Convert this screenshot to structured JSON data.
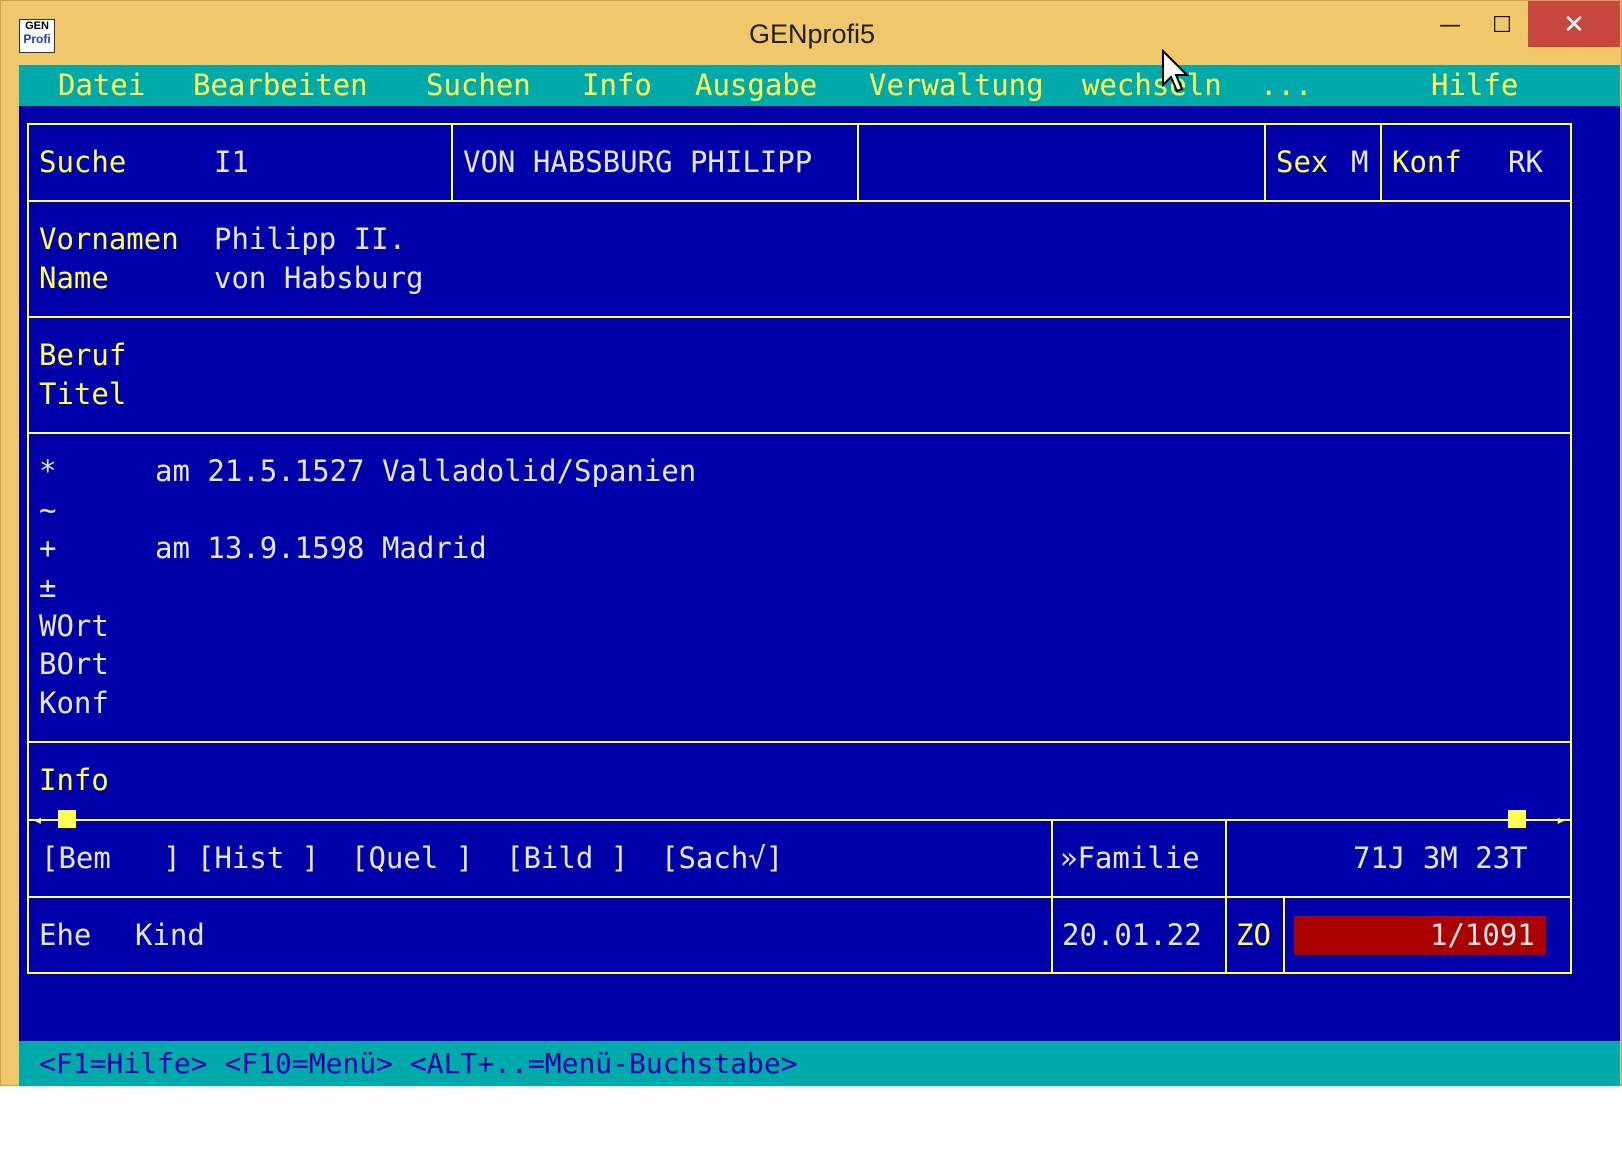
{
  "window": {
    "title": "GENprofi5",
    "icon_top": "GEN",
    "icon_bottom": "Profi",
    "minimize_glyph": "—",
    "maximize_glyph": "☐",
    "close_glyph": "✕"
  },
  "menu": {
    "datei": "Datei",
    "bearbeiten": "Bearbeiten",
    "suchen": "Suchen",
    "info": "Info",
    "ausgabe": "Ausgabe",
    "verwaltung": "Verwaltung",
    "wechseln": "wechseln",
    "more": "...",
    "hilfe": "Hilfe"
  },
  "header": {
    "suche_label": "Suche",
    "suche_value": "I1",
    "name_upper": "VON HABSBURG PHILIPP",
    "sex_label": "Sex",
    "sex_value": "M",
    "konf_label": "Konf",
    "konf_value": "RK"
  },
  "names": {
    "vornamen_label": "Vornamen",
    "vornamen_value": "Philipp II.",
    "name_label": "Name",
    "name_value": "von Habsburg"
  },
  "profession": {
    "beruf_label": "Beruf",
    "titel_label": "Titel"
  },
  "events": {
    "birth_symbol": "*",
    "birth_text": "am 21.5.1527 Valladolid/Spanien",
    "baptism_symbol": "~",
    "death_symbol": "+",
    "death_text": "am 13.9.1598 Madrid",
    "burial_symbol": "±",
    "wort_label": "WOrt",
    "bort_label": "BOrt",
    "konf_label": "Konf"
  },
  "info": {
    "label": "Info"
  },
  "attachments": {
    "bem": "[Bem   ]",
    "hist": "[Hist ]",
    "quel": "[Quel ]",
    "bild": "[Bild ]",
    "sach": "[Sach√]",
    "familie": "»Familie",
    "age": "71J 3M 23T"
  },
  "footer": {
    "ehe": "Ehe",
    "kind": "Kind",
    "date": "20.01.22",
    "zo": "ZO",
    "record": "1/1091"
  },
  "status": {
    "text": "<F1=Hilfe> <F10=Menü> <ALT+..=Menü-Buchstabe>"
  }
}
